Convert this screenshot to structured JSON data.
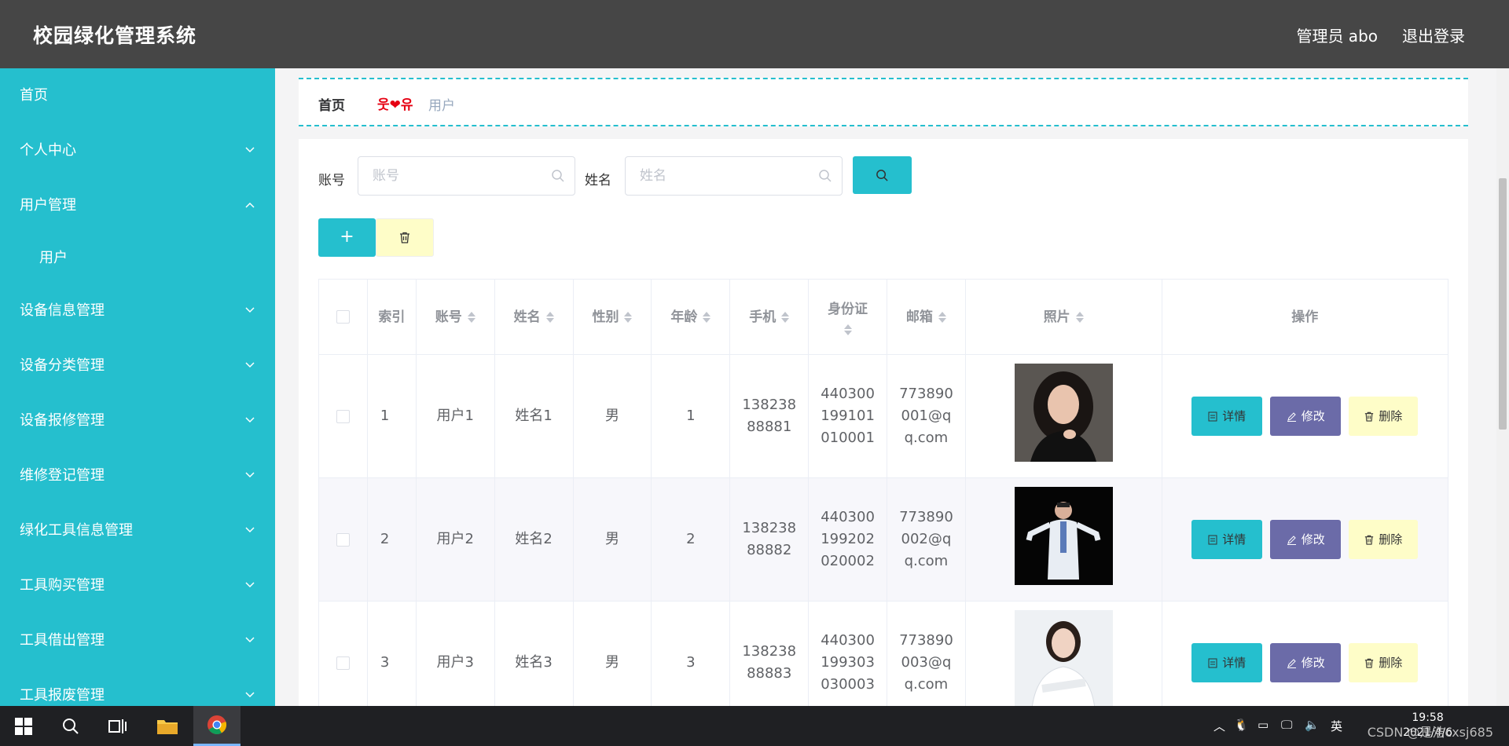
{
  "header": {
    "title": "校园绿化管理系统",
    "user_label": "管理员 abo",
    "logout_label": "退出登录"
  },
  "sidebar": {
    "items": [
      {
        "label": "首页",
        "has_chevron": false
      },
      {
        "label": "个人中心",
        "has_chevron": true,
        "expanded": false
      },
      {
        "label": "用户管理",
        "has_chevron": true,
        "expanded": true
      },
      {
        "label": "用户",
        "has_chevron": false,
        "sub": true
      },
      {
        "label": "设备信息管理",
        "has_chevron": true,
        "expanded": false
      },
      {
        "label": "设备分类管理",
        "has_chevron": true,
        "expanded": false
      },
      {
        "label": "设备报修管理",
        "has_chevron": true,
        "expanded": false
      },
      {
        "label": "维修登记管理",
        "has_chevron": true,
        "expanded": false
      },
      {
        "label": "绿化工具信息管理",
        "has_chevron": true,
        "expanded": false
      },
      {
        "label": "工具购买管理",
        "has_chevron": true,
        "expanded": false
      },
      {
        "label": "工具借出管理",
        "has_chevron": true,
        "expanded": false
      },
      {
        "label": "工具报废管理",
        "has_chevron": true,
        "expanded": false
      }
    ]
  },
  "breadcrumb": {
    "home": "首页",
    "separator": "웃❤유",
    "current": "用户"
  },
  "search": {
    "account_label": "账号",
    "account_placeholder": "账号",
    "name_label": "姓名",
    "name_placeholder": "姓名"
  },
  "toolbar": {
    "add_label": "+"
  },
  "table": {
    "headers": [
      "索引",
      "账号",
      "姓名",
      "性别",
      "年龄",
      "手机",
      "身份证",
      "邮箱",
      "照片",
      "操作"
    ],
    "rows": [
      {
        "index": "1",
        "account": "用户1",
        "name": "姓名1",
        "gender": "男",
        "age": "1",
        "phone": "13823888881",
        "id_card": "440300199101010001",
        "email": "773890001@qq.com",
        "photo": "woman-portrait"
      },
      {
        "index": "2",
        "account": "用户2",
        "name": "姓名2",
        "gender": "男",
        "age": "2",
        "phone": "13823888882",
        "id_card": "440300199202020002",
        "email": "773890002@qq.com",
        "photo": "man-portrait"
      },
      {
        "index": "3",
        "account": "用户3",
        "name": "姓名3",
        "gender": "男",
        "age": "3",
        "phone": "13823888883",
        "id_card": "440300199303030003",
        "email": "773890003@qq.com",
        "photo": "woman-portrait-2"
      }
    ],
    "actions": {
      "detail": "详情",
      "edit": "修改",
      "delete": "删除"
    }
  },
  "taskbar": {
    "time": "19:58",
    "date": "2021/4/6",
    "ime": "英",
    "watermark": "CSDN @是浩cxsj685"
  },
  "colors": {
    "accent": "#25bfce",
    "header_bg": "#464646",
    "edit_btn": "#6b6ba8",
    "delete_btn": "#fefdc8"
  }
}
